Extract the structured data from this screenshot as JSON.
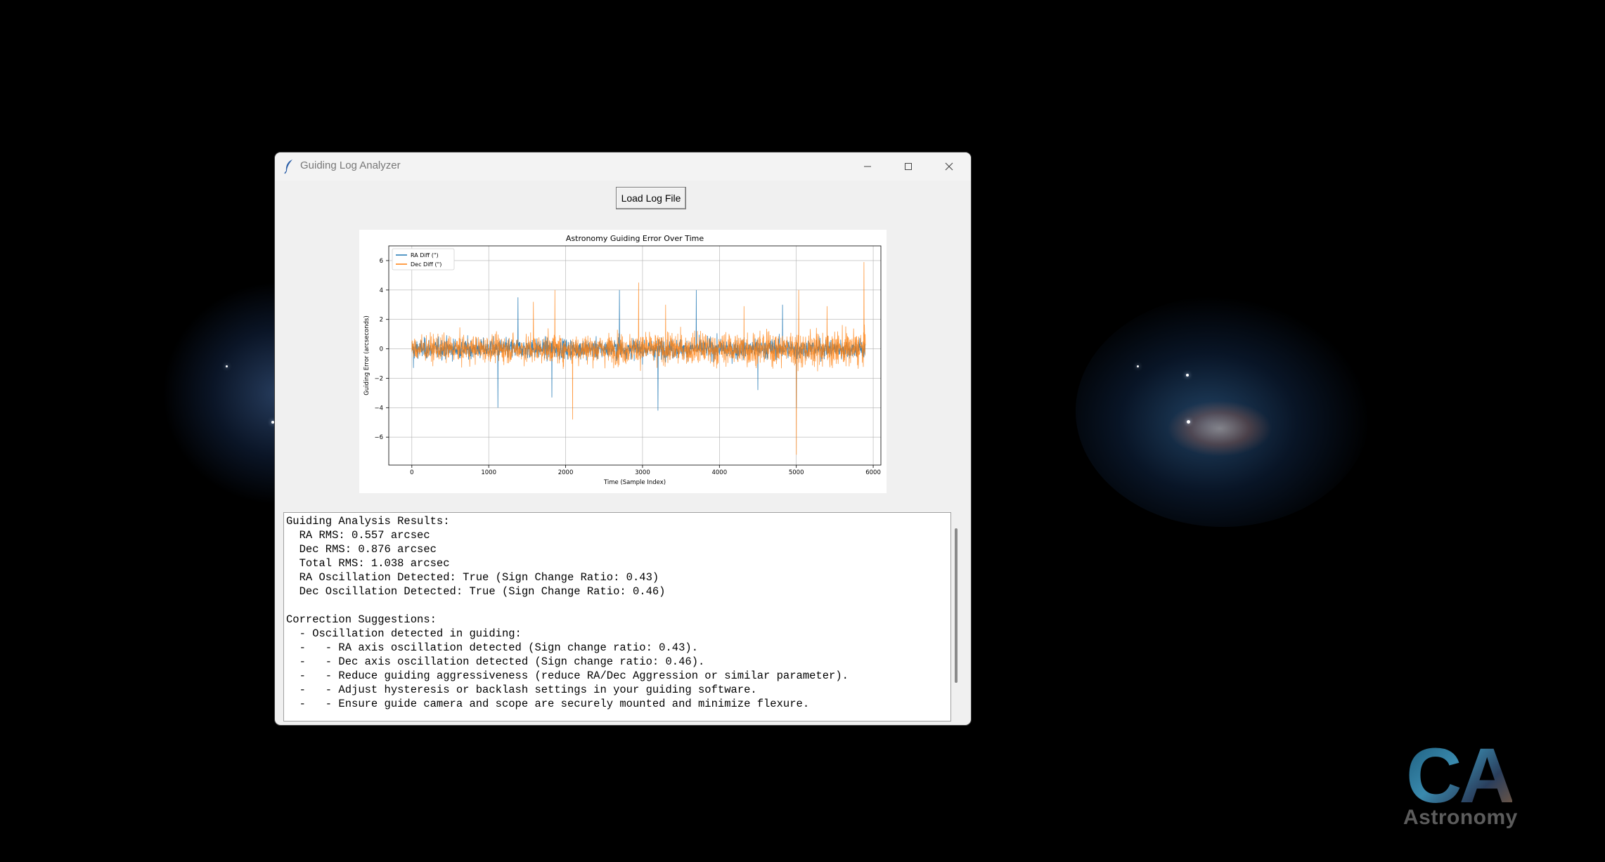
{
  "window": {
    "title": "Guiding Log Analyzer"
  },
  "toolbar": {
    "load_label": "Load Log File"
  },
  "icons": {
    "app": "feather-icon",
    "minimize": "minimize-icon",
    "maximize": "maximize-icon",
    "close": "close-icon"
  },
  "chart_data": {
    "type": "line",
    "title": "Astronomy Guiding Error Over Time",
    "xlabel": "Time (Sample Index)",
    "ylabel": "Guiding Error (arcseconds)",
    "xlim": [
      -300,
      6100
    ],
    "ylim": [
      -7.9,
      7.0
    ],
    "xticks": [
      0,
      1000,
      2000,
      3000,
      4000,
      5000,
      6000
    ],
    "yticks": [
      -6,
      -4,
      -2,
      0,
      2,
      4,
      6
    ],
    "grid": true,
    "legend": "top-left",
    "n_samples": 5900,
    "series": [
      {
        "name": "RA Diff (\")",
        "color": "#1f77b4",
        "band": {
          "typical_low": -0.9,
          "typical_high": 1.0
        },
        "spikes": [
          {
            "x": 20,
            "y": -1.3
          },
          {
            "x": 1120,
            "y": -4.0
          },
          {
            "x": 1380,
            "y": 3.5
          },
          {
            "x": 1820,
            "y": -3.3
          },
          {
            "x": 2700,
            "y": 4.0
          },
          {
            "x": 3200,
            "y": -4.2
          },
          {
            "x": 3700,
            "y": 4.0
          },
          {
            "x": 4500,
            "y": -2.8
          },
          {
            "x": 4820,
            "y": 3.0
          },
          {
            "x": 5000,
            "y": -4.0
          }
        ]
      },
      {
        "name": "Dec Diff (\")",
        "color": "#ff7f0e",
        "band": {
          "typical_low": -1.4,
          "typical_high": 1.5
        },
        "spikes": [
          {
            "x": 1580,
            "y": 3.2
          },
          {
            "x": 1860,
            "y": 4.0
          },
          {
            "x": 2090,
            "y": -4.8
          },
          {
            "x": 2950,
            "y": 4.5
          },
          {
            "x": 3300,
            "y": 3.0
          },
          {
            "x": 4320,
            "y": 2.9
          },
          {
            "x": 5000,
            "y": -7.2
          },
          {
            "x": 5030,
            "y": 4.0
          },
          {
            "x": 5400,
            "y": 2.9
          },
          {
            "x": 5880,
            "y": 5.9
          }
        ]
      }
    ]
  },
  "results": {
    "lines": [
      "Guiding Analysis Results:",
      "  RA RMS: 0.557 arcsec",
      "  Dec RMS: 0.876 arcsec",
      "  Total RMS: 1.038 arcsec",
      "  RA Oscillation Detected: True (Sign Change Ratio: 0.43)",
      "  Dec Oscillation Detected: True (Sign Change Ratio: 0.46)",
      "",
      "Correction Suggestions:",
      "  - Oscillation detected in guiding:",
      "  -   - RA axis oscillation detected (Sign change ratio: 0.43).",
      "  -   - Dec axis oscillation detected (Sign change ratio: 0.46).",
      "  -   - Reduce guiding aggressiveness (reduce RA/Dec Aggression or similar parameter).",
      "  -   - Adjust hysteresis or backlash settings in your guiding software.",
      "  -   - Ensure guide camera and scope are securely mounted and minimize flexure."
    ]
  },
  "logo": {
    "letters": "CA",
    "word": "Astronomy"
  }
}
